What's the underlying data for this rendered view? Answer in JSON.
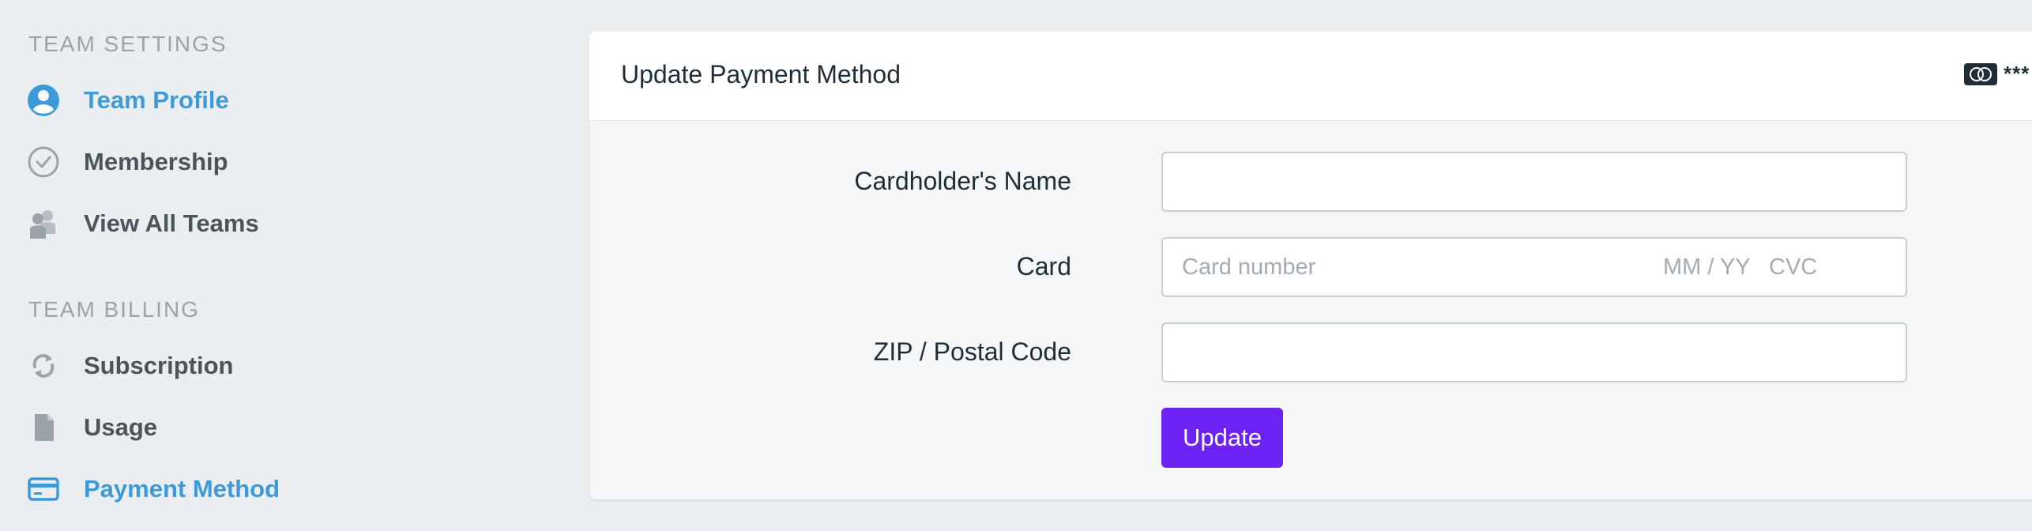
{
  "sidebar": {
    "team_settings": {
      "heading": "TEAM SETTINGS",
      "items": [
        {
          "label": "Team Profile",
          "icon": "user-circle-icon",
          "active": true
        },
        {
          "label": "Membership",
          "icon": "check-circle-icon",
          "active": false
        },
        {
          "label": "View All Teams",
          "icon": "users-icon",
          "active": false
        }
      ]
    },
    "team_billing": {
      "heading": "TEAM BILLING",
      "items": [
        {
          "label": "Subscription",
          "icon": "refresh-icon",
          "active": false
        },
        {
          "label": "Usage",
          "icon": "document-icon",
          "active": false
        },
        {
          "label": "Payment Method",
          "icon": "credit-card-icon",
          "active": true
        }
      ]
    }
  },
  "panel": {
    "title": "Update Payment Method",
    "card_brand_icon": "mastercard-icon",
    "card_mask": "***"
  },
  "form": {
    "cardholder_label": "Cardholder's Name",
    "cardholder_value": "",
    "card_label": "Card",
    "card_number_placeholder": "Card number",
    "expiry_placeholder": "MM / YY",
    "cvc_placeholder": "CVC",
    "zip_label": "ZIP / Postal Code",
    "zip_value": "",
    "update_label": "Update"
  },
  "colors": {
    "accent": "#3d9ad8",
    "button": "#6b22f2",
    "nav_text": "#4a545b",
    "heading_text": "#9aa3aa",
    "background": "#ebeef1"
  }
}
